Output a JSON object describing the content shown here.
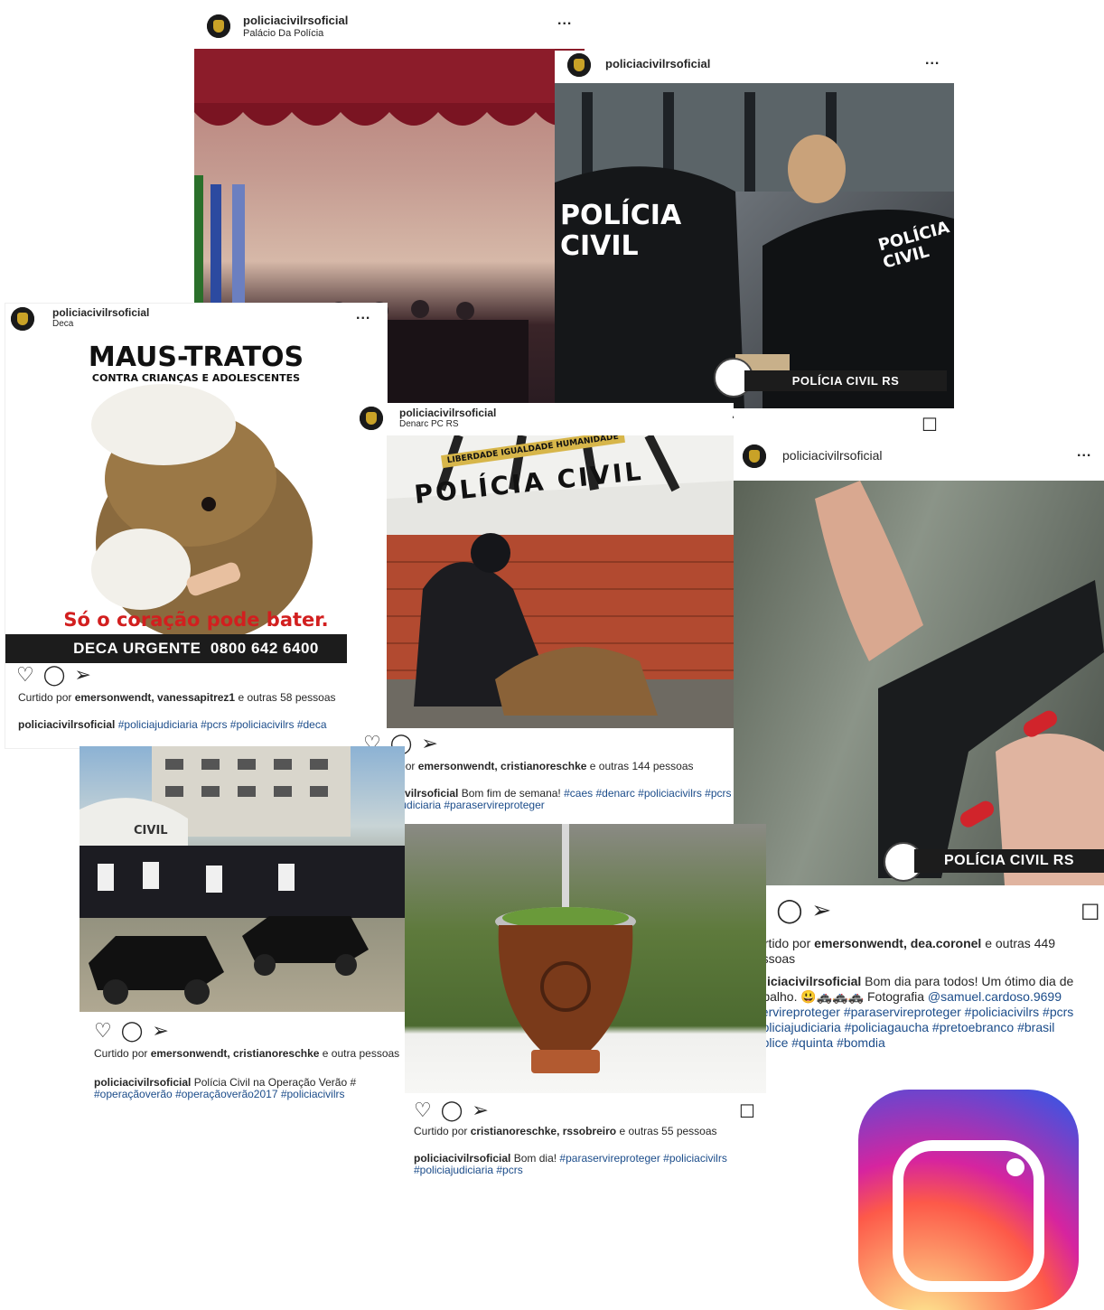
{
  "colors": {
    "instagram_gradient": [
      "#feda75",
      "#fa7e1e",
      "#d62976",
      "#962fbf",
      "#4f5bd5"
    ],
    "link": "#1b4c8a"
  },
  "posts": {
    "palacio": {
      "user": "policiacivilrsoficial",
      "location": "Palácio Da Polícia",
      "more": "..."
    },
    "dupla": {
      "user": "policiacivilrsoficial",
      "more": "...",
      "jacket_left": "POLÍCIA CIVIL",
      "jacket_right": "POLÍCIA CIVIL",
      "badge": "POLÍCIA CIVIL RS",
      "save_icon": "bookmark-icon"
    },
    "deca": {
      "user": "policiacivilrsoficial",
      "location": "Deca",
      "more": "...",
      "headline": "MAUS-TRATOS",
      "subline": "CONTRA CRIANÇAS E ADOLESCENTES",
      "tagline": "Só o coração pode bater.",
      "footer": "DECA URGENTE  0800 642 6400",
      "likes_prefix": "Curtido por ",
      "likes_users": "emersonwendt, vanessapitrez1",
      "likes_suffix": " e outras 58 pessoas",
      "caption_user": "policiacivilrsoficial",
      "caption_tags": "#policiajudiciaria #pcrs #policiacivilrs #deca"
    },
    "denarc": {
      "user": "policiacivilrsoficial",
      "location": "Denarc PC RS",
      "more": "...",
      "wall_text": "POLÍCIA CIVIL",
      "banner": "LIBERDADE IGUALDADE HUMANIDADE",
      "likes_prefix": "Curtido por ",
      "likes_users": "emersonwendt, cristianoreschke",
      "likes_suffix": " e outras 144 pessoas",
      "caption_user": "policiacivilrsoficial",
      "caption_text": " Bom fim de semana! ",
      "caption_tags": "#caes #denarc #policiacivilrs #pcrs #policiajudiciaria #paraservireproteger"
    },
    "arma": {
      "user": "policiacivilrsoficial",
      "more": "...",
      "badge": "POLÍCIA CIVIL RS",
      "likes_prefix": "Curtido por ",
      "likes_users": "emersonwendt, dea.coronel",
      "likes_suffix": " e outras 449 pessoas",
      "caption_user": "policiacivilrsoficial",
      "caption_text": " Bom dia para todos! Um ótimo dia de trabalho. 😃🚓🚓🚓 Fotografia ",
      "caption_mention": "@samuel.cardoso.9699",
      "caption_tags": "#servireproteger #paraservireproteger #policiacivilrs #pcrs #policiajudiciaria #policiagaucha #pretoebranco #brasil #police #quinta #bomdia"
    },
    "verao": {
      "sign": "CIVIL",
      "likes_prefix": "Curtido por ",
      "likes_users": "emersonwendt, cristianoreschke",
      "likes_suffix": " e outra pessoas",
      "caption_user": "policiacivilrsoficial",
      "caption_text": " Polícia Civil na Operação Verão #",
      "caption_tags": "#operaçãoverão #operaçãoverão2017 #policiacivilrs"
    },
    "chimarrao": {
      "likes_prefix": "Curtido por ",
      "likes_users": "cristianoreschke, rssobreiro",
      "likes_suffix": " e outras 55 pessoas",
      "caption_user": "policiacivilrsoficial",
      "caption_text": " Bom dia! ",
      "caption_tags": "#paraservireproteger #policiacivilrs #policiajudiciaria #pcrs"
    }
  },
  "icons": {
    "like": "heart-icon",
    "comment": "comment-icon",
    "share": "share-icon",
    "save": "bookmark-icon",
    "logo": "instagram-logo-icon"
  }
}
